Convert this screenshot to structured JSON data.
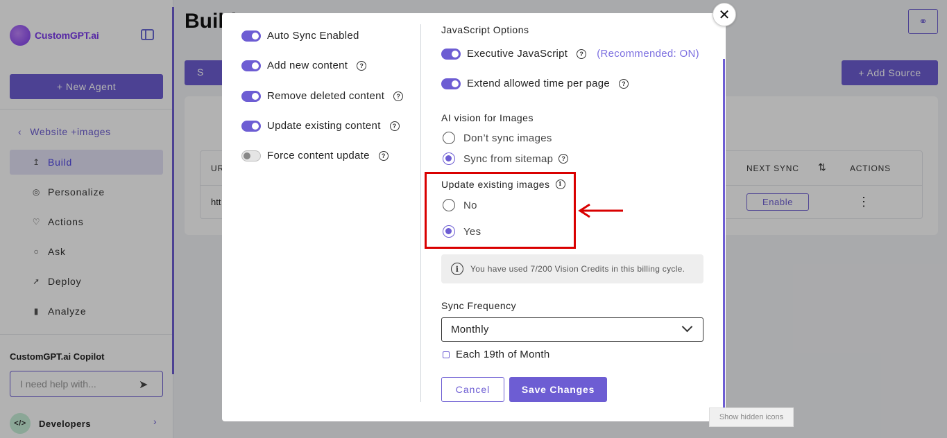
{
  "sidebar": {
    "logo_text": "CustomGPT.ai",
    "new_agent_label": "+  New Agent",
    "back_label": "Website +images",
    "nav": [
      {
        "label": "Build",
        "icon": "build-icon"
      },
      {
        "label": "Personalize",
        "icon": "palette-icon"
      },
      {
        "label": "Actions",
        "icon": "actions-icon"
      },
      {
        "label": "Ask",
        "icon": "chat-icon"
      },
      {
        "label": "Deploy",
        "icon": "rocket-icon"
      },
      {
        "label": "Analyze",
        "icon": "chart-icon"
      }
    ],
    "copilot_title": "CustomGPT.ai Copilot",
    "copilot_placeholder": "I need help with...",
    "developers_label": "Developers"
  },
  "main": {
    "title": "Build",
    "tab_label": "S",
    "add_source_label": "+ Add Source",
    "table": {
      "col_url": "UR",
      "col_next_sync": "NEXT SYNC",
      "col_actions": "ACTIONS",
      "row_url": "htt",
      "enable_label": "Enable"
    }
  },
  "modal": {
    "left_toggles": [
      {
        "label": "Auto Sync Enabled",
        "on": true,
        "help": false
      },
      {
        "label": "Add new content",
        "on": true,
        "help": true
      },
      {
        "label": "Remove deleted content",
        "on": true,
        "help": true
      },
      {
        "label": "Update existing content",
        "on": true,
        "help": true
      },
      {
        "label": "Force content update",
        "on": false,
        "help": true
      }
    ],
    "js_options_label": "JavaScript Options",
    "exec_js_label": "Executive JavaScript",
    "exec_js_recommend": "(Recommended: ON)",
    "extend_time_label": "Extend allowed time per page",
    "ai_vision_label": "AI vision for Images",
    "ai_vision_options": [
      {
        "label": "Don’t sync images",
        "selected": false
      },
      {
        "label": "Sync from sitemap",
        "selected": true
      }
    ],
    "update_images_label": "Update existing images",
    "update_images_options": [
      {
        "label": "No",
        "selected": false
      },
      {
        "label": "Yes",
        "selected": true
      }
    ],
    "credits_text": "You have used 7/200 Vision Credits in this billing cycle.",
    "sync_frequency_label": "Sync Frequency",
    "sync_frequency_value": "Monthly",
    "schedule_text": "Each 19th of Month",
    "cancel_label": "Cancel",
    "save_label": "Save Changes"
  },
  "tooltip_text": "Show hidden icons",
  "colors": {
    "accent": "#6d5dd3",
    "highlight": "#d90000"
  }
}
